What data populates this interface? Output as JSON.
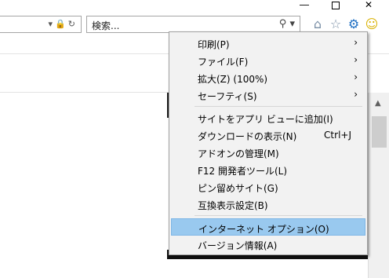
{
  "search": {
    "placeholder": "検索..."
  },
  "icons": {
    "address": [
      "dropdown-arrow",
      "lock",
      "refresh"
    ],
    "search": [
      "magnifier",
      "dropdown-arrow"
    ],
    "toolbar": [
      "home",
      "star",
      "gear",
      "smiley"
    ]
  },
  "colors": {
    "menu_background": "#f2f2f2",
    "highlight": "#99c9ef",
    "gear": "#1e6fc3"
  },
  "menu": {
    "items": [
      {
        "label": "印刷(P)",
        "submenu": true
      },
      {
        "label": "ファイル(F)",
        "submenu": true
      },
      {
        "label": "拡大(Z) (100%)",
        "submenu": true
      },
      {
        "label": "セーフティ(S)",
        "submenu": true
      },
      {
        "label": "サイトをアプリ ビューに追加(I)"
      },
      {
        "label": "ダウンロードの表示(N)",
        "shortcut": "Ctrl+J"
      },
      {
        "label": "アドオンの管理(M)"
      },
      {
        "label": "F12 開発者ツール(L)"
      },
      {
        "label": "ピン留めサイト(G)"
      },
      {
        "label": "互換表示設定(B)"
      },
      {
        "label": "インターネット オプション(O)",
        "highlighted": true
      },
      {
        "label": "バージョン情報(A)"
      }
    ]
  }
}
